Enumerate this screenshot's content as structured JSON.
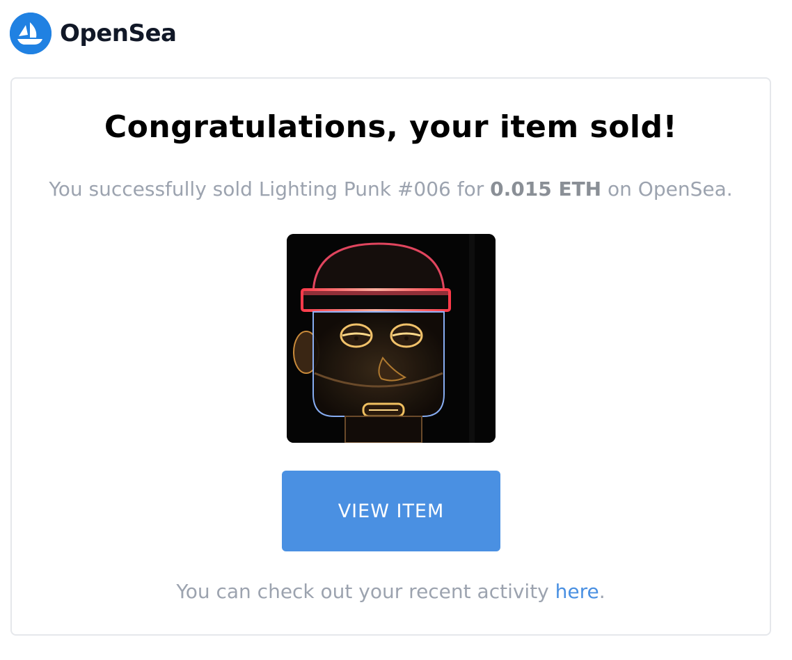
{
  "brand": {
    "name": "OpenSea",
    "logo_icon": "opensea-ship-icon",
    "logo_color": "#2081E2"
  },
  "email": {
    "headline": "Congratulations, your item sold!",
    "summary": {
      "prefix": "You successfully sold Lighting Punk #006 for ",
      "price": "0.015 ETH",
      "suffix": " on OpenSea."
    },
    "item_image": {
      "icon": "nft-neon-punk-image"
    },
    "button": {
      "label": "VIEW ITEM",
      "color": "#4A90E2"
    },
    "footer": {
      "prefix": "You can check out your recent activity ",
      "link_label": "here",
      "suffix": "."
    }
  },
  "colors": {
    "muted_text": "#9ca3af",
    "border": "#e5e7eb",
    "link": "#4A90E2"
  }
}
